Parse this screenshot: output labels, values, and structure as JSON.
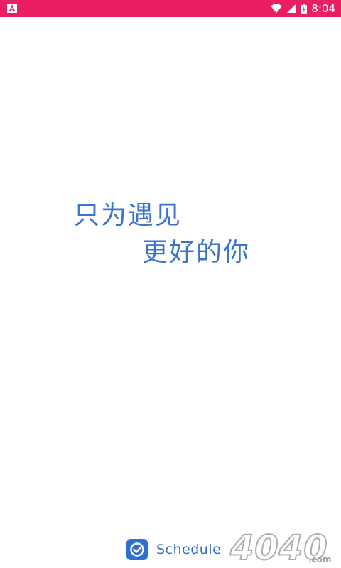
{
  "status_bar": {
    "time": "8:04",
    "background_color": "#e91e63",
    "icons": [
      "app-notification-icon",
      "wifi-icon",
      "cell-signal-icon",
      "battery-icon"
    ]
  },
  "splash": {
    "slogan_line_1": "只为遇见",
    "slogan_line_2": "更好的你",
    "text_color": "#3a74cc"
  },
  "brand": {
    "logo_icon": "check-badge-icon",
    "name": "Schedule",
    "color": "#2f6fcf"
  },
  "watermark": {
    "text": "4040",
    "suffix": ".com"
  }
}
